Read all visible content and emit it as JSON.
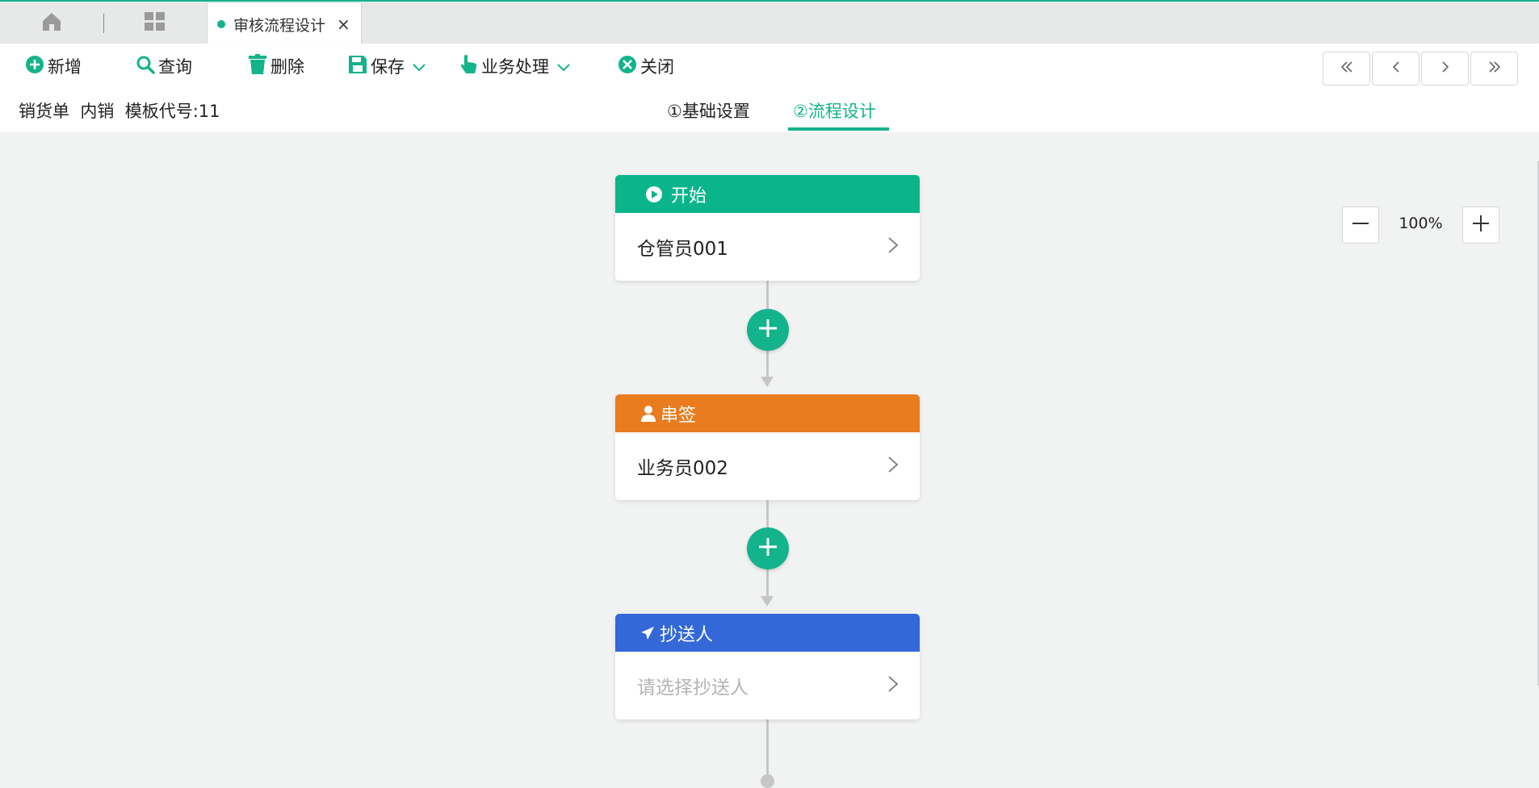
{
  "colors": {
    "accent": "#13b38b",
    "start": "#0bb58b",
    "approver": "#e97c1f",
    "cc": "#3468d8"
  },
  "tabs": {
    "active_title": "审核流程设计",
    "close_glyph": "×"
  },
  "toolbar": {
    "add_label": "新增",
    "query_label": "查询",
    "delete_label": "删除",
    "save_label": "保存",
    "business_label": "业务处理",
    "close_label": "关闭"
  },
  "info": {
    "doc_type": "销货单",
    "category": "内销",
    "template_code": "模板代号:11"
  },
  "steps": {
    "basic": "①基础设置",
    "flow": "②流程设计",
    "active": "flow"
  },
  "zoom": {
    "level": "100%"
  },
  "nodes": [
    {
      "header": "开始",
      "body": "仓管员001",
      "icon": "play-circle-icon"
    },
    {
      "header": "串签",
      "body": "业务员002",
      "icon": "user-icon"
    },
    {
      "header": "抄送人",
      "body": "请选择抄送人",
      "icon": "send-icon"
    }
  ]
}
